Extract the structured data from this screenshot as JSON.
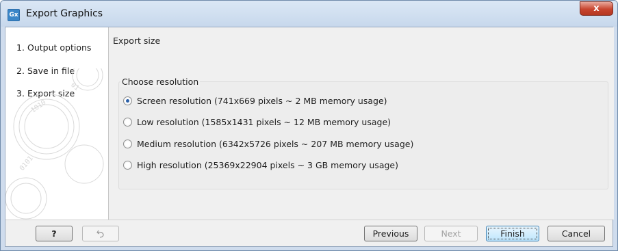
{
  "window": {
    "title": "Export Graphics",
    "app_icon": "Gx",
    "close_glyph": "x"
  },
  "wizard": {
    "steps": [
      {
        "num": "1.",
        "label": "Output options"
      },
      {
        "num": "2.",
        "label": "Save in file"
      },
      {
        "num": "3.",
        "label": "Export size"
      }
    ],
    "current_step": "Export size"
  },
  "main": {
    "title": "Export size",
    "group_label": "Choose resolution",
    "options": [
      {
        "label": "Screen resolution (741x669 pixels ~ 2 MB memory usage)",
        "checked": true
      },
      {
        "label": "Low resolution (1585x1431 pixels ~ 12 MB memory usage)",
        "checked": false
      },
      {
        "label": "Medium resolution (6342x5726 pixels ~ 207 MB memory usage)",
        "checked": false
      },
      {
        "label": "High resolution (25369x22904 pixels ~ 3 GB memory usage)",
        "checked": false
      }
    ]
  },
  "footer": {
    "help_label": "?",
    "reset_icon": "undo-icon",
    "previous_label": "Previous",
    "next_label": "Next",
    "finish_label": "Finish",
    "cancel_label": "Cancel"
  },
  "colors": {
    "accent": "#3a86c8",
    "close": "#c8452f",
    "frame": "#cfdced"
  }
}
